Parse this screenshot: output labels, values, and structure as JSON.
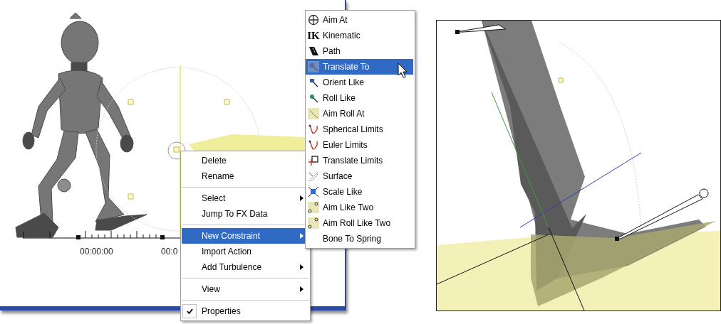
{
  "left_viewport": {
    "timeline": {
      "labels": [
        "00:00:00",
        "00:0"
      ]
    }
  },
  "context_menu": {
    "groups": [
      [
        {
          "label": "Delete",
          "selected": false,
          "submenu": false,
          "checked": false
        },
        {
          "label": "Rename",
          "selected": false,
          "submenu": false,
          "checked": false
        }
      ],
      [
        {
          "label": "Select",
          "selected": false,
          "submenu": true,
          "checked": false
        },
        {
          "label": "Jump To FX Data",
          "selected": false,
          "submenu": false,
          "checked": false
        }
      ],
      [
        {
          "label": "New Constraint",
          "selected": true,
          "submenu": true,
          "checked": false
        },
        {
          "label": "Import Action",
          "selected": false,
          "submenu": false,
          "checked": false
        },
        {
          "label": "Add Turbulence",
          "selected": false,
          "submenu": true,
          "checked": false
        }
      ],
      [
        {
          "label": "View",
          "selected": false,
          "submenu": true,
          "checked": false
        }
      ],
      [
        {
          "label": "Properties",
          "selected": false,
          "submenu": false,
          "checked": true
        }
      ]
    ]
  },
  "constraint_submenu": {
    "items": [
      {
        "label": "Aim At",
        "kind": "crosshair",
        "selected": false
      },
      {
        "label": "Kinematic",
        "kind": "letters",
        "icon_text": "IK",
        "selected": false
      },
      {
        "label": "Path",
        "kind": "path",
        "selected": false
      },
      {
        "label": "Translate To",
        "kind": "translate",
        "selected": true
      },
      {
        "label": "Orient Like",
        "kind": "orient",
        "selected": false
      },
      {
        "label": "Roll Like",
        "kind": "roll",
        "selected": false
      },
      {
        "label": "Aim Roll At",
        "kind": "aimroll",
        "selected": false
      },
      {
        "label": "Spherical Limits",
        "kind": "limits",
        "selected": false
      },
      {
        "label": "Euler Limits",
        "kind": "limits",
        "selected": false
      },
      {
        "label": "Translate Limits",
        "kind": "square",
        "selected": false
      },
      {
        "label": "Surface",
        "kind": "surface",
        "selected": false
      },
      {
        "label": "Scale Like",
        "kind": "scale",
        "selected": false
      },
      {
        "label": "Aim Like Two",
        "kind": "two",
        "selected": false
      },
      {
        "label": "Aim Roll Like Two",
        "kind": "two",
        "selected": false
      },
      {
        "label": "Bone To Spring",
        "kind": "plain",
        "selected": false
      }
    ]
  }
}
